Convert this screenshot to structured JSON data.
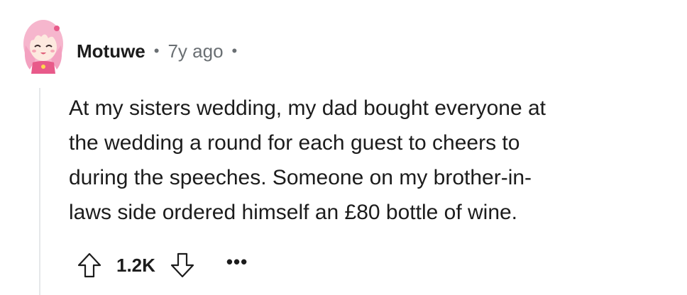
{
  "comment": {
    "avatar_icon": "anime-girl-avatar-icon",
    "username": "Motuwe",
    "separator": "•",
    "timestamp": "7y ago",
    "trailing_separator": "•",
    "body_lines": [
      "At my sisters wedding, my dad bought everyone at",
      "the wedding a round for each guest to cheers to",
      "during the speeches. Someone on my brother-in-",
      "laws side ordered himself an £80 bottle of wine."
    ],
    "score": "1.2K",
    "upvote_icon": "arrow-up-icon",
    "downvote_icon": "arrow-down-icon",
    "more_label": "•••"
  },
  "colors": {
    "text": "#1c1c1c",
    "meta": "#6a6f73",
    "thread_line": "#e6e8ea",
    "avatar_hair": "#f2a7c3"
  }
}
